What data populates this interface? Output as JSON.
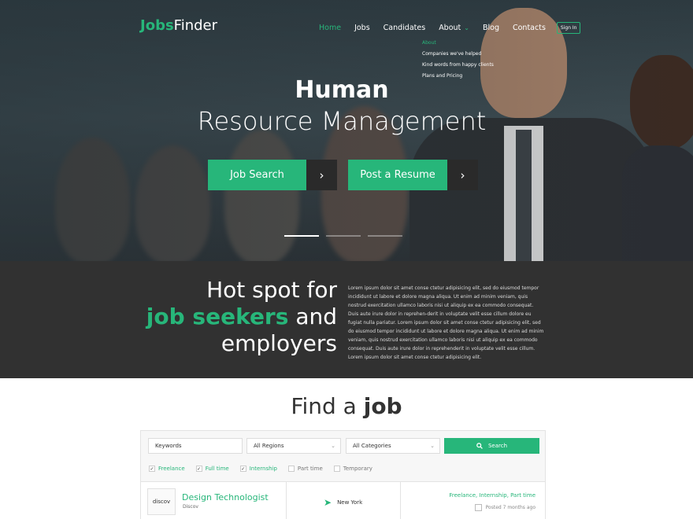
{
  "brand": {
    "logo_bold": "Jobs",
    "logo_rest": "Finder"
  },
  "nav": {
    "items": [
      "Home",
      "Jobs",
      "Candidates",
      "About",
      "Blog",
      "Contacts"
    ],
    "signin": "Sign In",
    "about_submenu": [
      "About",
      "Companies we've helped",
      "Kind words from happy clients",
      "Plans and Pricing"
    ]
  },
  "hero": {
    "title": "Human",
    "subtitle": "Resource Management",
    "buttons": [
      "Job Search",
      "Post a Resume"
    ],
    "slides": 3,
    "active_slide": 1
  },
  "promo": {
    "line1": "Hot spot for",
    "line2_green": "job seekers",
    "line2_rest": "and",
    "line3": "employers",
    "text": "Lorem ipsum dolor sit amet conse ctetur adipisicing elit, sed do eiusmod tempor incididunt ut labore et dolore magna aliqua. Ut enim ad minim veniam, quis nostrud exercitation ullamco laboris nisi ut aliquip ex ea commodo consequat. Duis aute irure dolor in reprehen-derit in voluptate velit esse cillum dolore eu fugiat nulla pariatur.  Lorem ipsum dolor sit amet conse ctetur adipisicing elit, sed do eiusmod tempor incididunt ut labore et dolore magna aliqua. Ut enim ad minim veniam, quis nostrud exercitation ullamco laboris nisi ut aliquip ex ea commodo consequat. Duis aute irure dolor in reprehenderit in voluptate velit esse cillum. Lorem ipsum dolor sit amet conse ctetur adipisicing elit."
  },
  "find": {
    "title_light": "Find a",
    "title_bold": "job",
    "keywords_placeholder": "Keywords",
    "region": "All Regions",
    "category": "All Categories",
    "search_label": "Search",
    "filters": [
      {
        "label": "Freelance",
        "checked": true
      },
      {
        "label": "Full time",
        "checked": true
      },
      {
        "label": "Internship",
        "checked": true
      },
      {
        "label": "Part time",
        "checked": false
      },
      {
        "label": "Temporary",
        "checked": false
      }
    ]
  },
  "job": {
    "logo_text": "discov",
    "title": "Design Technologist",
    "company": "Discov",
    "location": "New York",
    "types": "Freelance,  Internship,  Part time",
    "posted": "Posted 7 months ago"
  },
  "colors": {
    "accent": "#27b67a",
    "dark": "#313131"
  }
}
